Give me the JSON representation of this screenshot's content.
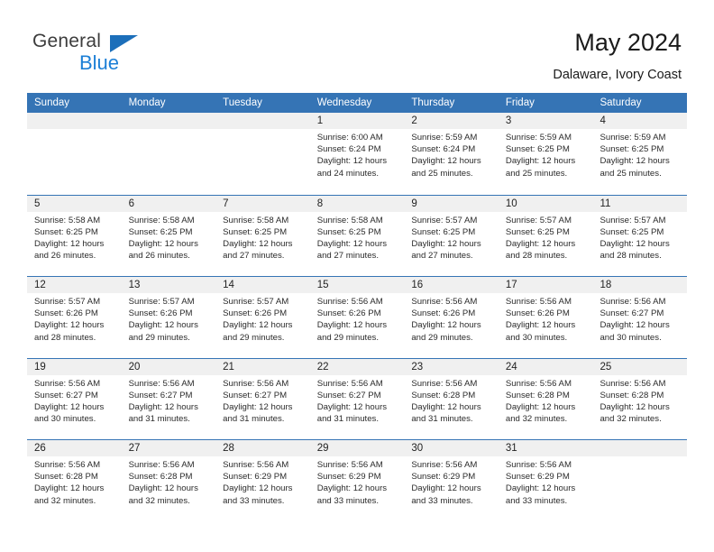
{
  "logo": {
    "word_one": "General",
    "word_two": "Blue",
    "triangle_color": "#1c6fba",
    "blue_color": "#1c7fd6"
  },
  "header": {
    "title": "May 2024",
    "subtitle": "Dalaware, Ivory Coast"
  },
  "theme": {
    "header_blue": "#3574b5",
    "band_gray": "#f0f0f0",
    "text": "#2b2b2b"
  },
  "weekdays": [
    "Sunday",
    "Monday",
    "Tuesday",
    "Wednesday",
    "Thursday",
    "Friday",
    "Saturday"
  ],
  "weeks": [
    [
      {
        "day": "",
        "lines": []
      },
      {
        "day": "",
        "lines": []
      },
      {
        "day": "",
        "lines": []
      },
      {
        "day": "1",
        "lines": [
          "Sunrise: 6:00 AM",
          "Sunset: 6:24 PM",
          "Daylight: 12 hours and 24 minutes."
        ]
      },
      {
        "day": "2",
        "lines": [
          "Sunrise: 5:59 AM",
          "Sunset: 6:24 PM",
          "Daylight: 12 hours and 25 minutes."
        ]
      },
      {
        "day": "3",
        "lines": [
          "Sunrise: 5:59 AM",
          "Sunset: 6:25 PM",
          "Daylight: 12 hours and 25 minutes."
        ]
      },
      {
        "day": "4",
        "lines": [
          "Sunrise: 5:59 AM",
          "Sunset: 6:25 PM",
          "Daylight: 12 hours and 25 minutes."
        ]
      }
    ],
    [
      {
        "day": "5",
        "lines": [
          "Sunrise: 5:58 AM",
          "Sunset: 6:25 PM",
          "Daylight: 12 hours and 26 minutes."
        ]
      },
      {
        "day": "6",
        "lines": [
          "Sunrise: 5:58 AM",
          "Sunset: 6:25 PM",
          "Daylight: 12 hours and 26 minutes."
        ]
      },
      {
        "day": "7",
        "lines": [
          "Sunrise: 5:58 AM",
          "Sunset: 6:25 PM",
          "Daylight: 12 hours and 27 minutes."
        ]
      },
      {
        "day": "8",
        "lines": [
          "Sunrise: 5:58 AM",
          "Sunset: 6:25 PM",
          "Daylight: 12 hours and 27 minutes."
        ]
      },
      {
        "day": "9",
        "lines": [
          "Sunrise: 5:57 AM",
          "Sunset: 6:25 PM",
          "Daylight: 12 hours and 27 minutes."
        ]
      },
      {
        "day": "10",
        "lines": [
          "Sunrise: 5:57 AM",
          "Sunset: 6:25 PM",
          "Daylight: 12 hours and 28 minutes."
        ]
      },
      {
        "day": "11",
        "lines": [
          "Sunrise: 5:57 AM",
          "Sunset: 6:25 PM",
          "Daylight: 12 hours and 28 minutes."
        ]
      }
    ],
    [
      {
        "day": "12",
        "lines": [
          "Sunrise: 5:57 AM",
          "Sunset: 6:26 PM",
          "Daylight: 12 hours and 28 minutes."
        ]
      },
      {
        "day": "13",
        "lines": [
          "Sunrise: 5:57 AM",
          "Sunset: 6:26 PM",
          "Daylight: 12 hours and 29 minutes."
        ]
      },
      {
        "day": "14",
        "lines": [
          "Sunrise: 5:57 AM",
          "Sunset: 6:26 PM",
          "Daylight: 12 hours and 29 minutes."
        ]
      },
      {
        "day": "15",
        "lines": [
          "Sunrise: 5:56 AM",
          "Sunset: 6:26 PM",
          "Daylight: 12 hours and 29 minutes."
        ]
      },
      {
        "day": "16",
        "lines": [
          "Sunrise: 5:56 AM",
          "Sunset: 6:26 PM",
          "Daylight: 12 hours and 29 minutes."
        ]
      },
      {
        "day": "17",
        "lines": [
          "Sunrise: 5:56 AM",
          "Sunset: 6:26 PM",
          "Daylight: 12 hours and 30 minutes."
        ]
      },
      {
        "day": "18",
        "lines": [
          "Sunrise: 5:56 AM",
          "Sunset: 6:27 PM",
          "Daylight: 12 hours and 30 minutes."
        ]
      }
    ],
    [
      {
        "day": "19",
        "lines": [
          "Sunrise: 5:56 AM",
          "Sunset: 6:27 PM",
          "Daylight: 12 hours and 30 minutes."
        ]
      },
      {
        "day": "20",
        "lines": [
          "Sunrise: 5:56 AM",
          "Sunset: 6:27 PM",
          "Daylight: 12 hours and 31 minutes."
        ]
      },
      {
        "day": "21",
        "lines": [
          "Sunrise: 5:56 AM",
          "Sunset: 6:27 PM",
          "Daylight: 12 hours and 31 minutes."
        ]
      },
      {
        "day": "22",
        "lines": [
          "Sunrise: 5:56 AM",
          "Sunset: 6:27 PM",
          "Daylight: 12 hours and 31 minutes."
        ]
      },
      {
        "day": "23",
        "lines": [
          "Sunrise: 5:56 AM",
          "Sunset: 6:28 PM",
          "Daylight: 12 hours and 31 minutes."
        ]
      },
      {
        "day": "24",
        "lines": [
          "Sunrise: 5:56 AM",
          "Sunset: 6:28 PM",
          "Daylight: 12 hours and 32 minutes."
        ]
      },
      {
        "day": "25",
        "lines": [
          "Sunrise: 5:56 AM",
          "Sunset: 6:28 PM",
          "Daylight: 12 hours and 32 minutes."
        ]
      }
    ],
    [
      {
        "day": "26",
        "lines": [
          "Sunrise: 5:56 AM",
          "Sunset: 6:28 PM",
          "Daylight: 12 hours and 32 minutes."
        ]
      },
      {
        "day": "27",
        "lines": [
          "Sunrise: 5:56 AM",
          "Sunset: 6:28 PM",
          "Daylight: 12 hours and 32 minutes."
        ]
      },
      {
        "day": "28",
        "lines": [
          "Sunrise: 5:56 AM",
          "Sunset: 6:29 PM",
          "Daylight: 12 hours and 33 minutes."
        ]
      },
      {
        "day": "29",
        "lines": [
          "Sunrise: 5:56 AM",
          "Sunset: 6:29 PM",
          "Daylight: 12 hours and 33 minutes."
        ]
      },
      {
        "day": "30",
        "lines": [
          "Sunrise: 5:56 AM",
          "Sunset: 6:29 PM",
          "Daylight: 12 hours and 33 minutes."
        ]
      },
      {
        "day": "31",
        "lines": [
          "Sunrise: 5:56 AM",
          "Sunset: 6:29 PM",
          "Daylight: 12 hours and 33 minutes."
        ]
      },
      {
        "day": "",
        "lines": []
      }
    ]
  ]
}
